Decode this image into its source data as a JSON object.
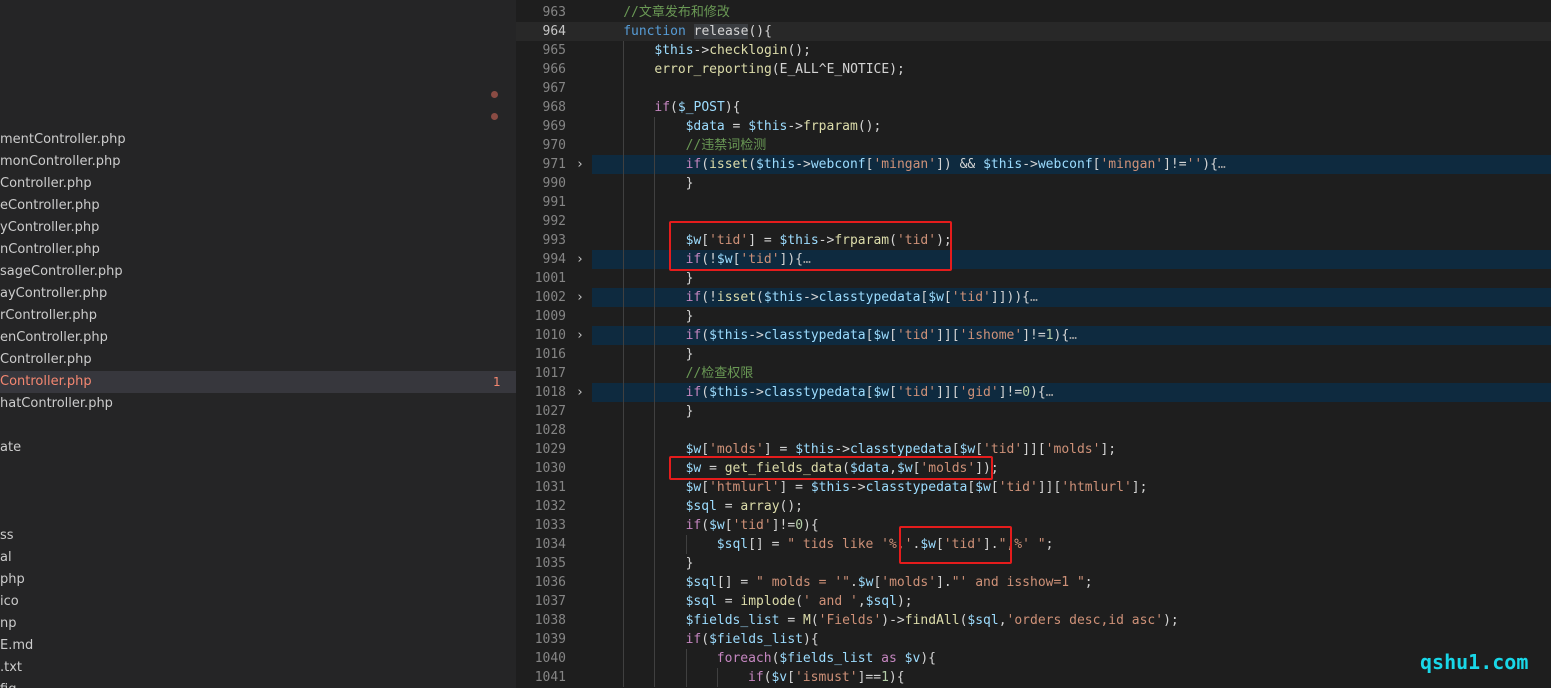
{
  "sidebar": {
    "items": [
      {
        "label": "mentController.php"
      },
      {
        "label": "monController.php"
      },
      {
        "label": "Controller.php"
      },
      {
        "label": "eController.php"
      },
      {
        "label": "yController.php"
      },
      {
        "label": "nController.php"
      },
      {
        "label": "sageController.php"
      },
      {
        "label": "ayController.php"
      },
      {
        "label": "rController.php"
      },
      {
        "label": "enController.php"
      },
      {
        "label": "Controller.php"
      },
      {
        "label": "Controller.php",
        "active": true,
        "badge": "1"
      },
      {
        "label": "hatController.php"
      },
      {
        "label": ""
      },
      {
        "label": "ate"
      },
      {
        "label": ""
      },
      {
        "label": ""
      },
      {
        "label": ""
      },
      {
        "label": "ss"
      },
      {
        "label": "al"
      },
      {
        "label": "php"
      },
      {
        "label": "ico"
      },
      {
        "label": "np"
      },
      {
        "label": "E.md"
      },
      {
        "label": ".txt"
      },
      {
        "label": "fig"
      }
    ]
  },
  "editor": {
    "current_line": "964",
    "lines": [
      {
        "n": "963",
        "indent": 1,
        "tokens": [
          [
            "cmt",
            "//文章发布和修改"
          ]
        ]
      },
      {
        "n": "964",
        "indent": 1,
        "tokens": [
          [
            "kw",
            "function "
          ],
          [
            "sel",
            "release"
          ],
          [
            "plain",
            "(){"
          ]
        ]
      },
      {
        "n": "965",
        "indent": 2,
        "tokens": [
          [
            "var",
            "$this"
          ],
          [
            "plain",
            "->"
          ],
          [
            "fn",
            "checklogin"
          ],
          [
            "plain",
            "();"
          ]
        ]
      },
      {
        "n": "966",
        "indent": 2,
        "tokens": [
          [
            "fn",
            "error_reporting"
          ],
          [
            "plain",
            "(E_ALL^E_NOTICE);"
          ]
        ]
      },
      {
        "n": "967",
        "indent": 2,
        "tokens": []
      },
      {
        "n": "968",
        "indent": 2,
        "tokens": [
          [
            "ctl",
            "if"
          ],
          [
            "plain",
            "("
          ],
          [
            "var",
            "$_POST"
          ],
          [
            "plain",
            "){"
          ]
        ]
      },
      {
        "n": "969",
        "indent": 3,
        "tokens": [
          [
            "var",
            "$data"
          ],
          [
            "plain",
            " = "
          ],
          [
            "var",
            "$this"
          ],
          [
            "plain",
            "->"
          ],
          [
            "fn",
            "frparam"
          ],
          [
            "plain",
            "();"
          ]
        ]
      },
      {
        "n": "970",
        "indent": 3,
        "tokens": [
          [
            "cmt",
            "//违禁词检测"
          ]
        ]
      },
      {
        "n": "971",
        "indent": 3,
        "fold": true,
        "tokens": [
          [
            "ctl",
            "if"
          ],
          [
            "plain",
            "("
          ],
          [
            "fn",
            "isset"
          ],
          [
            "plain",
            "("
          ],
          [
            "var",
            "$this"
          ],
          [
            "plain",
            "->"
          ],
          [
            "var",
            "webconf"
          ],
          [
            "plain",
            "["
          ],
          [
            "str",
            "'mingan'"
          ],
          [
            "plain",
            "]) && "
          ],
          [
            "var",
            "$this"
          ],
          [
            "plain",
            "->"
          ],
          [
            "var",
            "webconf"
          ],
          [
            "plain",
            "["
          ],
          [
            "str",
            "'mingan'"
          ],
          [
            "plain",
            "]!="
          ],
          [
            "str",
            "''"
          ],
          [
            "plain",
            "){"
          ],
          [
            "ell",
            "…"
          ]
        ]
      },
      {
        "n": "990",
        "indent": 3,
        "tokens": [
          [
            "plain",
            "}"
          ]
        ]
      },
      {
        "n": "991",
        "indent": 3,
        "tokens": []
      },
      {
        "n": "992",
        "indent": 3,
        "tokens": []
      },
      {
        "n": "993",
        "indent": 3,
        "tokens": [
          [
            "var",
            "$w"
          ],
          [
            "plain",
            "["
          ],
          [
            "str",
            "'tid'"
          ],
          [
            "plain",
            "] = "
          ],
          [
            "var",
            "$this"
          ],
          [
            "plain",
            "->"
          ],
          [
            "fn",
            "frparam"
          ],
          [
            "plain",
            "("
          ],
          [
            "str",
            "'tid'"
          ],
          [
            "plain",
            ");"
          ]
        ]
      },
      {
        "n": "994",
        "indent": 3,
        "fold": true,
        "tokens": [
          [
            "ctl",
            "if"
          ],
          [
            "plain",
            "(!"
          ],
          [
            "var",
            "$w"
          ],
          [
            "plain",
            "["
          ],
          [
            "str",
            "'tid'"
          ],
          [
            "plain",
            "]){"
          ],
          [
            "ell",
            "…"
          ]
        ]
      },
      {
        "n": "1001",
        "indent": 3,
        "tokens": [
          [
            "plain",
            "}"
          ]
        ]
      },
      {
        "n": "1002",
        "indent": 3,
        "fold": true,
        "tokens": [
          [
            "ctl",
            "if"
          ],
          [
            "plain",
            "(!"
          ],
          [
            "fn",
            "isset"
          ],
          [
            "plain",
            "("
          ],
          [
            "var",
            "$this"
          ],
          [
            "plain",
            "->"
          ],
          [
            "var",
            "classtypedata"
          ],
          [
            "plain",
            "["
          ],
          [
            "var",
            "$w"
          ],
          [
            "plain",
            "["
          ],
          [
            "str",
            "'tid'"
          ],
          [
            "plain",
            "]])){"
          ],
          [
            "ell",
            "…"
          ]
        ]
      },
      {
        "n": "1009",
        "indent": 3,
        "tokens": [
          [
            "plain",
            "}"
          ]
        ]
      },
      {
        "n": "1010",
        "indent": 3,
        "fold": true,
        "tokens": [
          [
            "ctl",
            "if"
          ],
          [
            "plain",
            "("
          ],
          [
            "var",
            "$this"
          ],
          [
            "plain",
            "->"
          ],
          [
            "var",
            "classtypedata"
          ],
          [
            "plain",
            "["
          ],
          [
            "var",
            "$w"
          ],
          [
            "plain",
            "["
          ],
          [
            "str",
            "'tid'"
          ],
          [
            "plain",
            "]]["
          ],
          [
            "str",
            "'ishome'"
          ],
          [
            "plain",
            "]!="
          ],
          [
            "num",
            "1"
          ],
          [
            "plain",
            "){"
          ],
          [
            "ell",
            "…"
          ]
        ]
      },
      {
        "n": "1016",
        "indent": 3,
        "tokens": [
          [
            "plain",
            "}"
          ]
        ]
      },
      {
        "n": "1017",
        "indent": 3,
        "tokens": [
          [
            "cmt",
            "//检查权限"
          ]
        ]
      },
      {
        "n": "1018",
        "indent": 3,
        "fold": true,
        "tokens": [
          [
            "ctl",
            "if"
          ],
          [
            "plain",
            "("
          ],
          [
            "var",
            "$this"
          ],
          [
            "plain",
            "->"
          ],
          [
            "var",
            "classtypedata"
          ],
          [
            "plain",
            "["
          ],
          [
            "var",
            "$w"
          ],
          [
            "plain",
            "["
          ],
          [
            "str",
            "'tid'"
          ],
          [
            "plain",
            "]]["
          ],
          [
            "str",
            "'gid'"
          ],
          [
            "plain",
            "]!="
          ],
          [
            "num",
            "0"
          ],
          [
            "plain",
            "){"
          ],
          [
            "ell",
            "…"
          ]
        ]
      },
      {
        "n": "1027",
        "indent": 3,
        "tokens": [
          [
            "plain",
            "}"
          ]
        ]
      },
      {
        "n": "1028",
        "indent": 3,
        "tokens": []
      },
      {
        "n": "1029",
        "indent": 3,
        "tokens": [
          [
            "var",
            "$w"
          ],
          [
            "plain",
            "["
          ],
          [
            "str",
            "'molds'"
          ],
          [
            "plain",
            "] = "
          ],
          [
            "var",
            "$this"
          ],
          [
            "plain",
            "->"
          ],
          [
            "var",
            "classtypedata"
          ],
          [
            "plain",
            "["
          ],
          [
            "var",
            "$w"
          ],
          [
            "plain",
            "["
          ],
          [
            "str",
            "'tid'"
          ],
          [
            "plain",
            "]]["
          ],
          [
            "str",
            "'molds'"
          ],
          [
            "plain",
            "];"
          ]
        ]
      },
      {
        "n": "1030",
        "indent": 3,
        "tokens": [
          [
            "var",
            "$w"
          ],
          [
            "plain",
            " = "
          ],
          [
            "fn",
            "get_fields_data"
          ],
          [
            "plain",
            "("
          ],
          [
            "var",
            "$data"
          ],
          [
            "plain",
            ","
          ],
          [
            "var",
            "$w"
          ],
          [
            "plain",
            "["
          ],
          [
            "str",
            "'molds'"
          ],
          [
            "plain",
            "]);"
          ]
        ]
      },
      {
        "n": "1031",
        "indent": 3,
        "tokens": [
          [
            "var",
            "$w"
          ],
          [
            "plain",
            "["
          ],
          [
            "str",
            "'htmlurl'"
          ],
          [
            "plain",
            "] = "
          ],
          [
            "var",
            "$this"
          ],
          [
            "plain",
            "->"
          ],
          [
            "var",
            "classtypedata"
          ],
          [
            "plain",
            "["
          ],
          [
            "var",
            "$w"
          ],
          [
            "plain",
            "["
          ],
          [
            "str",
            "'tid'"
          ],
          [
            "plain",
            "]]["
          ],
          [
            "str",
            "'htmlurl'"
          ],
          [
            "plain",
            "];"
          ]
        ]
      },
      {
        "n": "1032",
        "indent": 3,
        "tokens": [
          [
            "var",
            "$sql"
          ],
          [
            "plain",
            " = "
          ],
          [
            "fn",
            "array"
          ],
          [
            "plain",
            "();"
          ]
        ]
      },
      {
        "n": "1033",
        "indent": 3,
        "tokens": [
          [
            "ctl",
            "if"
          ],
          [
            "plain",
            "("
          ],
          [
            "var",
            "$w"
          ],
          [
            "plain",
            "["
          ],
          [
            "str",
            "'tid'"
          ],
          [
            "plain",
            "]!="
          ],
          [
            "num",
            "0"
          ],
          [
            "plain",
            "){"
          ]
        ]
      },
      {
        "n": "1034",
        "indent": 4,
        "tokens": [
          [
            "var",
            "$sql"
          ],
          [
            "plain",
            "[] = "
          ],
          [
            "str",
            "\" tids like '%,'"
          ],
          [
            "plain",
            "."
          ],
          [
            "var",
            "$w"
          ],
          [
            "plain",
            "["
          ],
          [
            "str",
            "'tid'"
          ],
          [
            "plain",
            "]."
          ],
          [
            "str",
            "\",%' \""
          ],
          [
            "plain",
            ";"
          ]
        ]
      },
      {
        "n": "1035",
        "indent": 3,
        "tokens": [
          [
            "plain",
            "}"
          ]
        ]
      },
      {
        "n": "1036",
        "indent": 3,
        "tokens": [
          [
            "var",
            "$sql"
          ],
          [
            "plain",
            "[] = "
          ],
          [
            "str",
            "\" molds = '\""
          ],
          [
            "plain",
            "."
          ],
          [
            "var",
            "$w"
          ],
          [
            "plain",
            "["
          ],
          [
            "str",
            "'molds'"
          ],
          [
            "plain",
            "]."
          ],
          [
            "str",
            "\"' and isshow=1 \""
          ],
          [
            "plain",
            ";"
          ]
        ]
      },
      {
        "n": "1037",
        "indent": 3,
        "tokens": [
          [
            "var",
            "$sql"
          ],
          [
            "plain",
            " = "
          ],
          [
            "fn",
            "implode"
          ],
          [
            "plain",
            "("
          ],
          [
            "str",
            "' and '"
          ],
          [
            "plain",
            ","
          ],
          [
            "var",
            "$sql"
          ],
          [
            "plain",
            ");"
          ]
        ]
      },
      {
        "n": "1038",
        "indent": 3,
        "tokens": [
          [
            "var",
            "$fields_list"
          ],
          [
            "plain",
            " = "
          ],
          [
            "fn",
            "M"
          ],
          [
            "plain",
            "("
          ],
          [
            "str",
            "'Fields'"
          ],
          [
            "plain",
            ")->"
          ],
          [
            "fn",
            "findAll"
          ],
          [
            "plain",
            "("
          ],
          [
            "var",
            "$sql"
          ],
          [
            "plain",
            ","
          ],
          [
            "str",
            "'orders desc,id asc'"
          ],
          [
            "plain",
            ");"
          ]
        ]
      },
      {
        "n": "1039",
        "indent": 3,
        "tokens": [
          [
            "ctl",
            "if"
          ],
          [
            "plain",
            "("
          ],
          [
            "var",
            "$fields_list"
          ],
          [
            "plain",
            "){"
          ]
        ]
      },
      {
        "n": "1040",
        "indent": 4,
        "tokens": [
          [
            "ctl",
            "foreach"
          ],
          [
            "plain",
            "("
          ],
          [
            "var",
            "$fields_list"
          ],
          [
            "plain",
            " "
          ],
          [
            "ctl",
            "as"
          ],
          [
            "plain",
            " "
          ],
          [
            "var",
            "$v"
          ],
          [
            "plain",
            "){"
          ]
        ]
      },
      {
        "n": "1041",
        "indent": 5,
        "tokens": [
          [
            "ctl",
            "if"
          ],
          [
            "plain",
            "("
          ],
          [
            "var",
            "$v"
          ],
          [
            "plain",
            "["
          ],
          [
            "str",
            "'ismust'"
          ],
          [
            "plain",
            "]=="
          ],
          [
            "num",
            "1"
          ],
          [
            "plain",
            "){"
          ]
        ]
      }
    ]
  },
  "watermark": "qshu1.com"
}
